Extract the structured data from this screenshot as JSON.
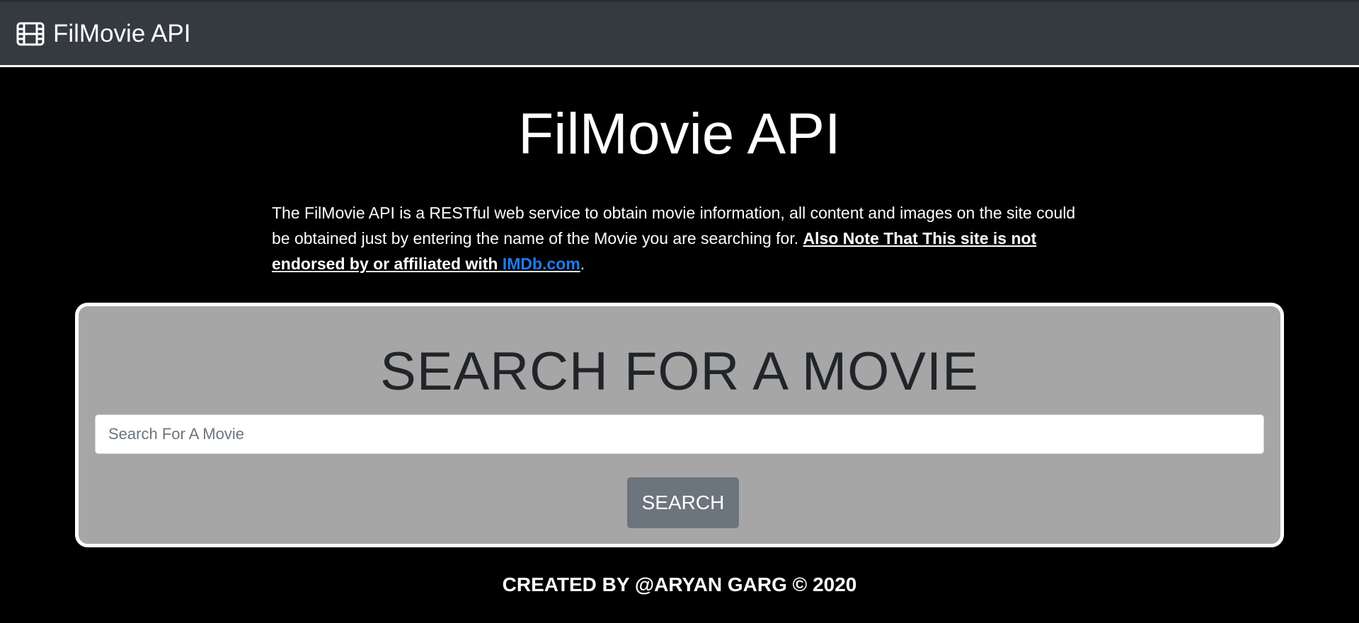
{
  "navbar": {
    "brand_icon": "film-icon",
    "brand_label": "FilMovie API"
  },
  "hero": {
    "title": "FilMovie API"
  },
  "intro": {
    "text": "The FilMovie API is a RESTful web service to obtain movie information, all content and images on the site could be obtained just by entering the name of the Movie you are searching for. ",
    "note": "Also Note That This site is not endorsed by or affiliated with ",
    "link_label": "IMDb.com",
    "trailing": "."
  },
  "search": {
    "heading": "SEARCH FOR A MOVIE",
    "placeholder": "Search For A Movie",
    "value": "",
    "button_label": "SEARCH"
  },
  "footer": {
    "text": "CREATED BY @ARYAN GARG © 2020"
  },
  "colors": {
    "navbar_bg": "#343a40",
    "page_bg": "#000000",
    "card_bg": "#a6a6a6",
    "link": "#1d7cf2",
    "button_bg": "#6c757d"
  }
}
